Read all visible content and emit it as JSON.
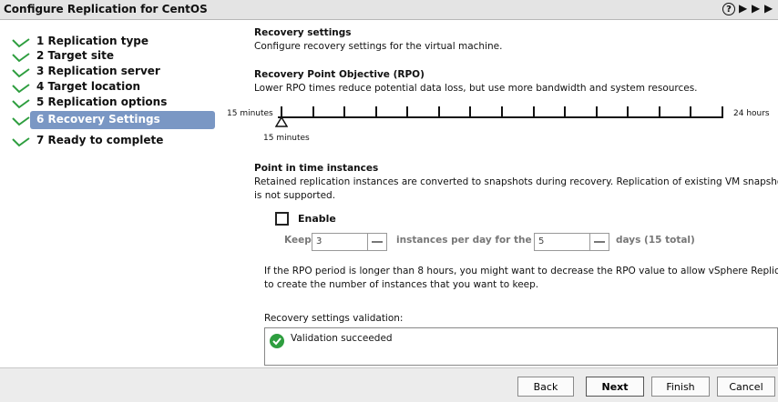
{
  "window": {
    "title": "Configure Replication for CentOS"
  },
  "steps": [
    {
      "label": "1 Replication type",
      "done": true
    },
    {
      "label": "2 Target site",
      "done": true
    },
    {
      "label": "3 Replication server",
      "done": true
    },
    {
      "label": "4 Target location",
      "done": true
    },
    {
      "label": "5 Replication options",
      "done": true
    },
    {
      "label": "6 Recovery Settings",
      "active": true
    },
    {
      "label": "7 Ready to complete",
      "done": true
    }
  ],
  "recovery": {
    "heading": "Recovery settings",
    "description": "Configure recovery settings for the virtual machine."
  },
  "rpo": {
    "heading": "Recovery Point Objective (RPO)",
    "description": "Lower RPO times reduce potential data loss, but use more bandwidth and system resources.",
    "min_label": "15 minutes",
    "max_label": "24 hours",
    "current_label": "15 minutes"
  },
  "pit": {
    "heading": "Point in time instances",
    "description_line1": "Retained replication instances are converted to snapshots during recovery. Replication of existing VM snapshots",
    "description_line2": "is not supported.",
    "enable_label": "Enable",
    "keep_label": "Keep",
    "instances_value": "3",
    "instances_label": "instances per day for the last",
    "days_value": "5",
    "days_label": "days (15 total)",
    "note_line1": "If the RPO period is longer than 8 hours, you might want to decrease the RPO value to allow vSphere Replication",
    "note_line2": "to create the number of instances that you want to keep."
  },
  "validation": {
    "label": "Recovery settings validation:",
    "message": "Validation succeeded"
  },
  "buttons": {
    "back": "Back",
    "next": "Next",
    "finish": "Finish",
    "cancel": "Cancel"
  },
  "colors": {
    "check": "#2e9e3f",
    "active_step": "#7a97c4"
  }
}
